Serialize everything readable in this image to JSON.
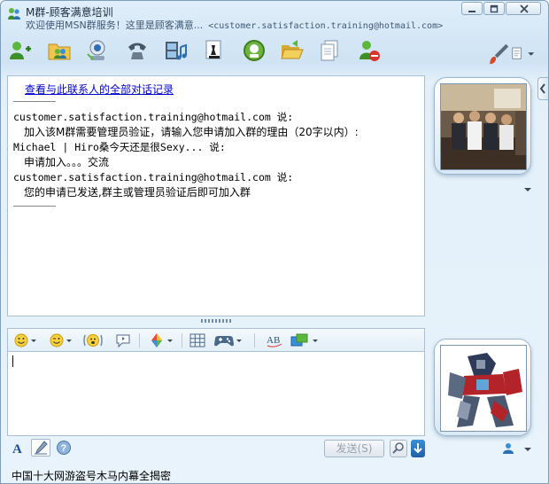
{
  "window": {
    "title": "M群-顾客满意培训",
    "subtitle": "欢迎使用MSN群服务！这里是顾客满意...",
    "contact_email": "<customer.satisfaction.training@hotmail.com>"
  },
  "toolbar": {
    "buttons": [
      {
        "name": "invite-contact",
        "icon": "add-person-icon"
      },
      {
        "name": "send-files",
        "icon": "folder-people-icon"
      },
      {
        "name": "video",
        "icon": "webcam-icon"
      },
      {
        "name": "call",
        "icon": "phone-icon"
      },
      {
        "name": "share",
        "icon": "film-music-icon"
      },
      {
        "name": "games",
        "icon": "chess-icon"
      },
      {
        "name": "block",
        "icon": "green-badge-icon"
      },
      {
        "name": "activities",
        "icon": "folder-open-icon"
      },
      {
        "name": "copy",
        "icon": "documents-icon"
      },
      {
        "name": "block-contact",
        "icon": "person-block-icon"
      }
    ]
  },
  "conversation": {
    "history_link": "查看与此联系人的全部对话记录",
    "messages": [
      {
        "sender": "customer.satisfaction.training@hotmail.com 说:",
        "text": "加入该M群需要管理员验证，请输入您申请加入群的理由（20字以内）:"
      },
      {
        "sender": "Michael | Hiro桑今天还是很Sexy... 说:",
        "text": "申请加入。。。交流"
      },
      {
        "sender": "customer.satisfaction.training@hotmail.com 说:",
        "text": "您的申请已发送,群主或管理员验证后即可加入群"
      }
    ]
  },
  "input": {
    "value": "",
    "send_label": "发送(S)"
  },
  "status_bar": {
    "text": "中国十大网游盗号木马内幕全揭密"
  },
  "colors": {
    "link": "#0000cc",
    "frame": "#7b9ebd",
    "background": "#dfeefa"
  }
}
